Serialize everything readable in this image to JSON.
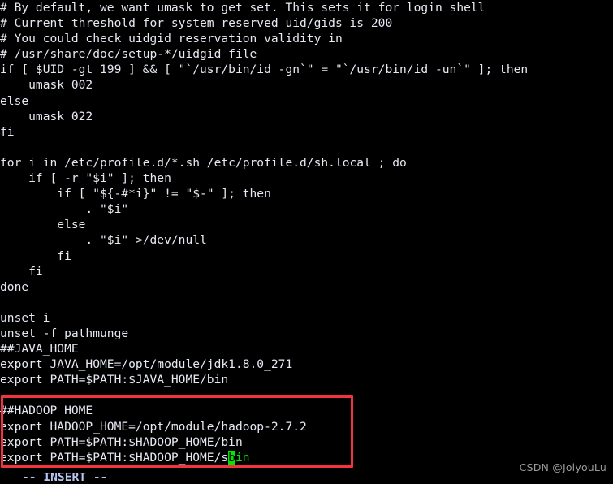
{
  "window": {
    "app": "vim",
    "background_color": "#000000",
    "foreground_color": "#e8e8f0"
  },
  "editor": {
    "lines": [
      "# By default, we want umask to get set. This sets it for login shell",
      "# Current threshold for system reserved uid/gids is 200",
      "# You could check uidgid reservation validity in",
      "# /usr/share/doc/setup-*/uidgid file",
      "if [ $UID -gt 199 ] && [ \"`/usr/bin/id -gn`\" = \"`/usr/bin/id -un`\" ]; then",
      "    umask 002",
      "else",
      "    umask 022",
      "fi",
      "",
      "for i in /etc/profile.d/*.sh /etc/profile.d/sh.local ; do",
      "    if [ -r \"$i\" ]; then",
      "        if [ \"${-#*i}\" != \"$-\" ]; then",
      "            . \"$i\"",
      "        else",
      "            . \"$i\" >/dev/null",
      "        fi",
      "    fi",
      "done",
      "",
      "unset i",
      "unset -f pathmunge",
      "##JAVA_HOME",
      "export JAVA_HOME=/opt/module/jdk1.8.0_271",
      "export PATH=$PATH:$JAVA_HOME/bin",
      "",
      "##HADOOP_HOME",
      "export HADOOP_HOME=/opt/module/hadoop-2.7.2",
      "export PATH=$PATH:$HADOOP_HOME/bin"
    ],
    "cursor_line": {
      "before": "export PATH=$PATH:$HADOOP_HOME/s",
      "cursor_char": "b",
      "after": "in"
    },
    "cursor_color": "#00e800"
  },
  "annotation": {
    "box_color": "#f5333f",
    "covers_lines": [
      "##HADOOP_HOME",
      "export HADOOP_HOME=/opt/module/hadoop-2.7.2",
      "export PATH=$PATH:$HADOOP_HOME/bin",
      "export PATH=$PATH:$HADOOP_HOME/sbin"
    ]
  },
  "status": {
    "mode_text": "-- INSERT --",
    "mode_color": "#b9c6f0"
  },
  "watermark": {
    "text": "CSDN @JolyouLu",
    "color": "#9a9a9a"
  }
}
